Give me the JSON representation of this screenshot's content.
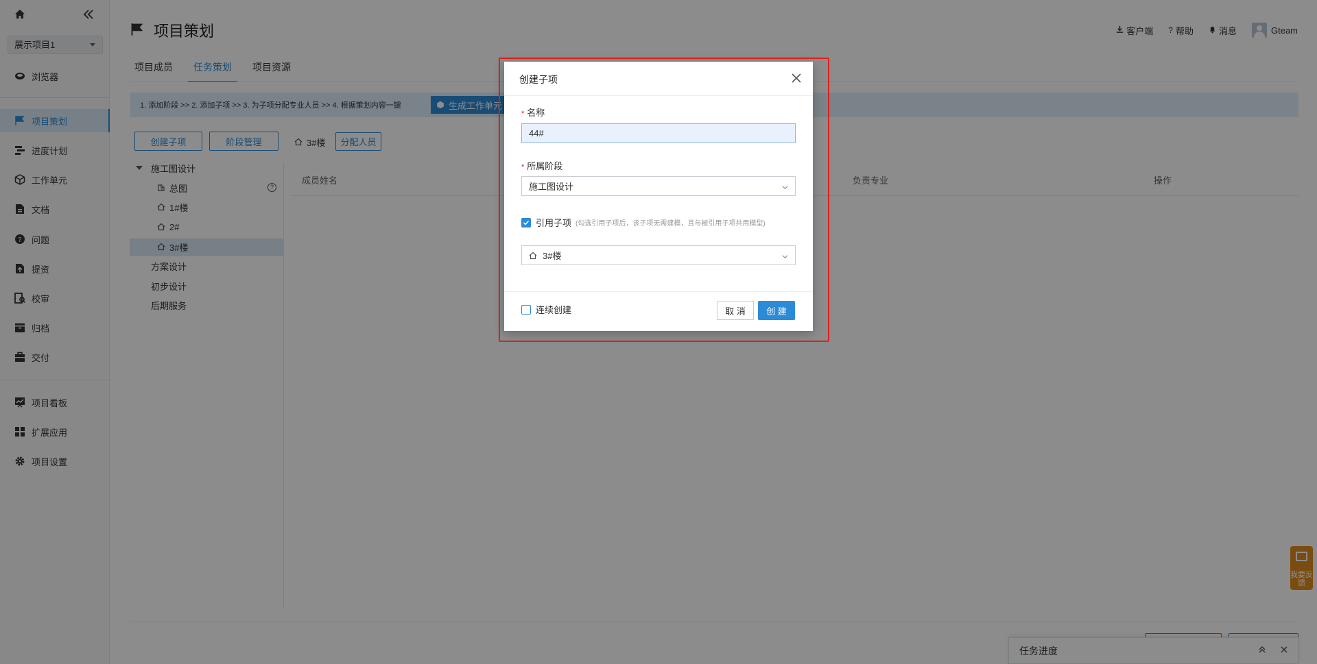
{
  "sidebar": {
    "project_select": "展示项目1",
    "items": [
      {
        "label": "浏览器"
      },
      {
        "label": "项目策划"
      },
      {
        "label": "进度计划"
      },
      {
        "label": "工作单元"
      },
      {
        "label": "文档"
      },
      {
        "label": "问题"
      },
      {
        "label": "提资"
      },
      {
        "label": "校审"
      },
      {
        "label": "归档"
      },
      {
        "label": "交付"
      },
      {
        "label": "项目看板"
      },
      {
        "label": "扩展应用"
      },
      {
        "label": "项目设置"
      }
    ]
  },
  "header": {
    "title": "项目策划",
    "tools": {
      "client": "客户端",
      "help": "帮助",
      "messages": "消息",
      "user": "Gteam"
    }
  },
  "tabs": [
    "项目成员",
    "任务策划",
    "项目资源"
  ],
  "steps_text": "1. 添加阶段  >>  2. 添加子项  >>  3. 为子项分配专业人员  >>  4. 根据策划内容一键",
  "generate_button": "生成工作单元",
  "left_actions": {
    "create_sub": "创建子项",
    "stage_manage": "阶段管理"
  },
  "tree": {
    "stage1": "施工图设计",
    "children": [
      "总图",
      "1#楼",
      "2#",
      "3#楼"
    ],
    "stages": [
      "方案设计",
      "初步设计",
      "后期服务"
    ]
  },
  "right_panel": {
    "selected_item": "3#楼",
    "assign_button": "分配人员",
    "columns": [
      "成员姓名",
      "负责专业",
      "操作"
    ]
  },
  "task_panel": {
    "title": "任务进度"
  },
  "feedback": {
    "label": "我要反馈"
  },
  "modal": {
    "title": "创建子项",
    "name_label": "名称",
    "name_value": "44#",
    "stage_label": "所属阶段",
    "stage_value": "施工图设计",
    "ref_label": "引用子项",
    "ref_hint": "(勾选引用子项后，该子项无需建模，且与被引用子项共用模型)",
    "ref_value": "3#楼",
    "continuous_label": "连续创建",
    "cancel": "取 消",
    "create": "创 建"
  }
}
